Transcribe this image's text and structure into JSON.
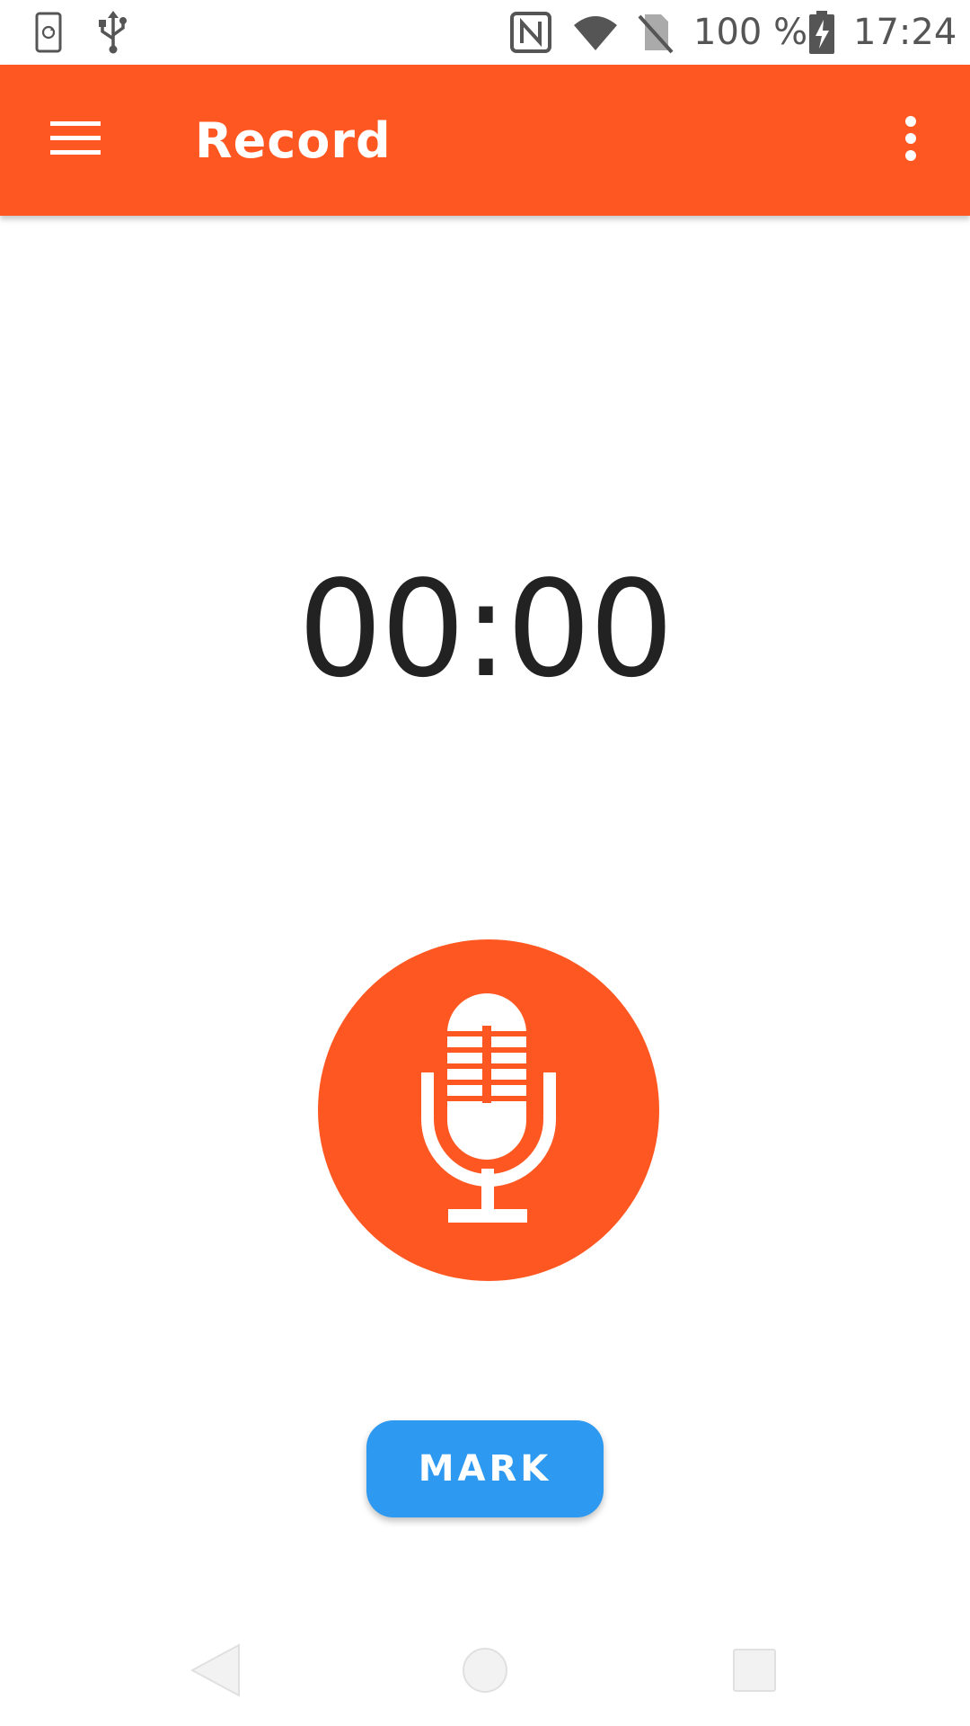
{
  "status_bar": {
    "battery_percent": "100 %",
    "time": "17:24",
    "icons": [
      "screen-rotate-icon",
      "usb-icon",
      "nfc-icon",
      "wifi-icon",
      "no-sim-icon",
      "battery-charging-icon"
    ]
  },
  "app_bar": {
    "title": "Record",
    "menu_icon": "hamburger-menu-icon",
    "overflow_icon": "more-vert-icon",
    "color": "#ff5722"
  },
  "recorder": {
    "timer": "00:00",
    "record_icon": "microphone-icon",
    "record_button_color": "#ff5722",
    "mark_label": "MARK",
    "mark_button_color": "#2e99f0"
  },
  "nav_bar": {
    "icons": [
      "back-icon",
      "home-icon",
      "recents-icon"
    ]
  }
}
